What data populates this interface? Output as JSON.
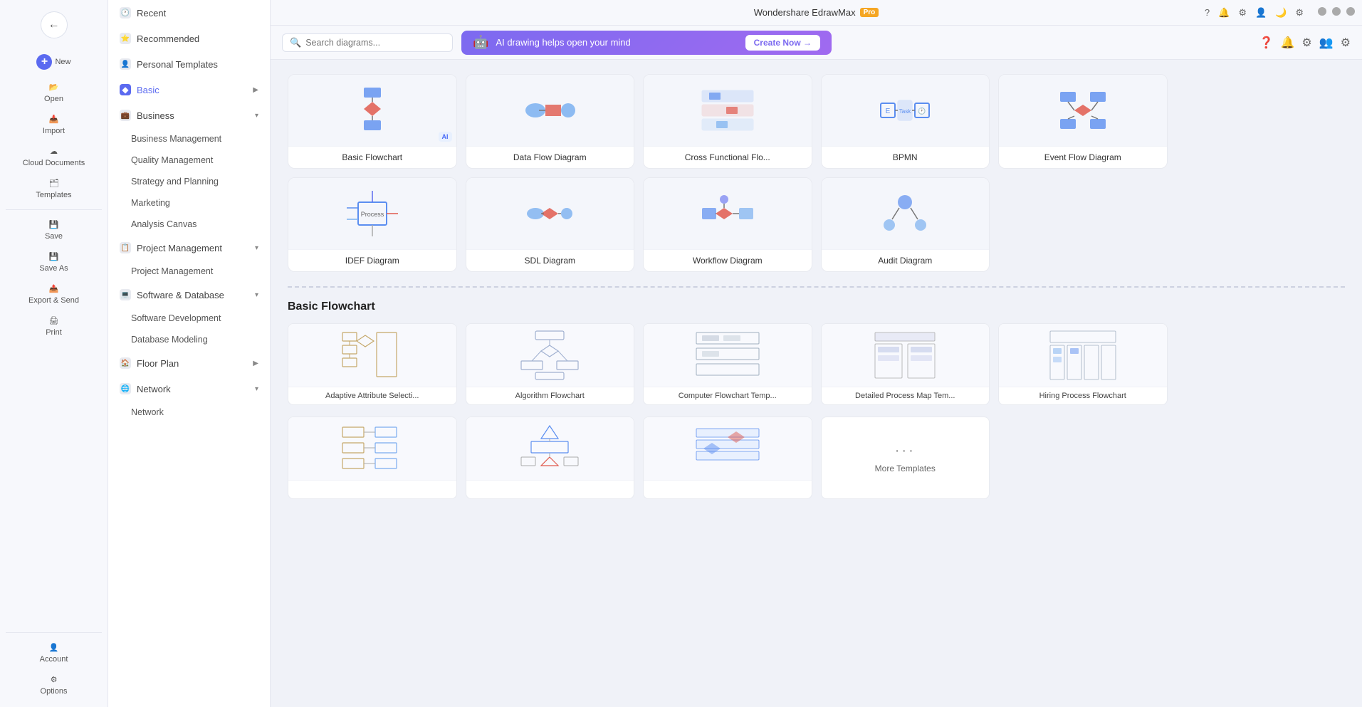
{
  "app": {
    "name": "Wondershare EdrawMax",
    "badge": "Pro",
    "title": "Wondershare EdrawMax"
  },
  "window_controls": {
    "minimize": "−",
    "maximize": "□",
    "close": "×"
  },
  "toolbar": {
    "search_placeholder": "Search diagrams...",
    "ai_banner_text": "AI drawing helps open your mind",
    "ai_banner_btn": "Create Now →",
    "icons": [
      "?",
      "🔔",
      "⚙",
      "👤",
      "⚙"
    ]
  },
  "left_sidebar": {
    "items": [
      {
        "id": "new",
        "label": "New",
        "icon": "+"
      },
      {
        "id": "open",
        "label": "Open",
        "icon": "📂"
      },
      {
        "id": "import",
        "label": "Import",
        "icon": "📥"
      },
      {
        "id": "cloud",
        "label": "Cloud Documents",
        "icon": "☁"
      },
      {
        "id": "templates",
        "label": "Templates",
        "icon": "🗂"
      },
      {
        "id": "save",
        "label": "Save",
        "icon": "💾"
      },
      {
        "id": "saveas",
        "label": "Save As",
        "icon": "💾"
      },
      {
        "id": "export",
        "label": "Export & Send",
        "icon": "📤"
      },
      {
        "id": "print",
        "label": "Print",
        "icon": "🖨"
      }
    ],
    "bottom_items": [
      {
        "id": "account",
        "label": "Account",
        "icon": "👤"
      },
      {
        "id": "options",
        "label": "Options",
        "icon": "⚙"
      }
    ]
  },
  "main_sidebar": {
    "sections": [
      {
        "id": "recent",
        "label": "Recent",
        "icon": "🕐",
        "expandable": false
      },
      {
        "id": "recommended",
        "label": "Recommended",
        "icon": "⭐",
        "expandable": false
      },
      {
        "id": "personal",
        "label": "Personal Templates",
        "icon": "👤",
        "expandable": false
      },
      {
        "id": "basic",
        "label": "Basic",
        "icon": "◆",
        "expandable": true,
        "active": true,
        "subitems": []
      },
      {
        "id": "business",
        "label": "Business",
        "icon": "💼",
        "expandable": true,
        "subitems": [
          "Business Management",
          "Quality Management",
          "Strategy and Planning",
          "Marketing",
          "Analysis Canvas"
        ]
      },
      {
        "id": "project",
        "label": "Project Management",
        "icon": "📋",
        "expandable": true,
        "subitems": [
          "Project Management"
        ]
      },
      {
        "id": "software",
        "label": "Software & Database",
        "icon": "💻",
        "expandable": true,
        "subitems": [
          "Software Development",
          "Database Modeling"
        ]
      },
      {
        "id": "floorplan",
        "label": "Floor Plan",
        "icon": "🏠",
        "expandable": true,
        "subitems": []
      },
      {
        "id": "network",
        "label": "Network",
        "icon": "🌐",
        "expandable": true,
        "subitems": [
          "Network"
        ]
      }
    ]
  },
  "diagram_types": [
    {
      "id": "basic-flowchart",
      "label": "Basic Flowchart",
      "has_ai": true
    },
    {
      "id": "data-flow",
      "label": "Data Flow Diagram",
      "has_ai": false
    },
    {
      "id": "cross-functional",
      "label": "Cross Functional Flo...",
      "has_ai": false
    },
    {
      "id": "bpmn",
      "label": "BPMN",
      "has_ai": false
    },
    {
      "id": "event-flow",
      "label": "Event Flow Diagram",
      "has_ai": false
    },
    {
      "id": "idef",
      "label": "IDEF Diagram",
      "has_ai": false
    },
    {
      "id": "sdl",
      "label": "SDL Diagram",
      "has_ai": false
    },
    {
      "id": "workflow",
      "label": "Workflow Diagram",
      "has_ai": false
    },
    {
      "id": "audit",
      "label": "Audit Diagram",
      "has_ai": false
    }
  ],
  "section_title": "Basic Flowchart",
  "templates": [
    {
      "id": "t1",
      "label": "Adaptive Attribute Selecti..."
    },
    {
      "id": "t2",
      "label": "Algorithm Flowchart"
    },
    {
      "id": "t3",
      "label": "Computer Flowchart Temp..."
    },
    {
      "id": "t4",
      "label": "Detailed Process Map Tem..."
    },
    {
      "id": "t5",
      "label": "Hiring Process Flowchart"
    },
    {
      "id": "t6",
      "label": ""
    },
    {
      "id": "t7",
      "label": ""
    },
    {
      "id": "t8",
      "label": ""
    },
    {
      "id": "t9",
      "label": "More Templates"
    }
  ]
}
